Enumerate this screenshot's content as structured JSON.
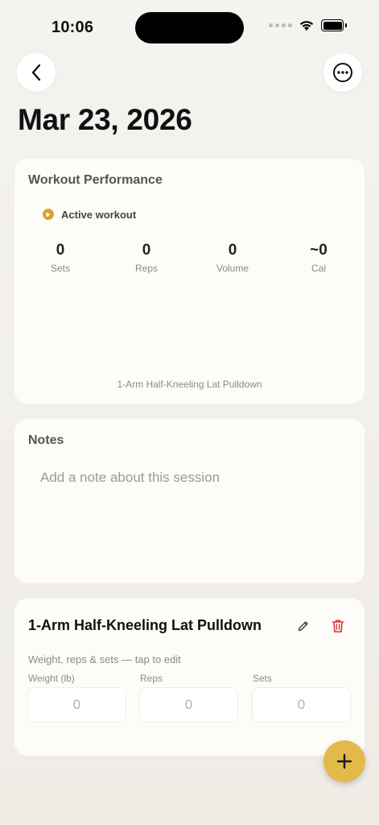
{
  "status_bar": {
    "time": "10:06"
  },
  "header": {
    "back_icon": "chevron-left-icon",
    "more_icon": "ellipsis-circle-icon",
    "title": "Mar 23, 2026"
  },
  "performance": {
    "title": "Workout Performance",
    "status_label": "Active workout",
    "accent_color": "#d4a62a",
    "stats": [
      {
        "value": "0",
        "label": "Sets"
      },
      {
        "value": "0",
        "label": "Reps"
      },
      {
        "value": "0",
        "label": "Volume"
      },
      {
        "value": "~0",
        "label": "Cal"
      }
    ],
    "exercise_caption": "1-Arm Half-Kneeling Lat Pulldown"
  },
  "notes": {
    "title": "Notes",
    "placeholder": "Add a note about this session",
    "value": ""
  },
  "exercise": {
    "name": "1-Arm Half-Kneeling Lat Pulldown",
    "edit_icon": "pencil-icon",
    "delete_icon": "trash-icon",
    "delete_color": "#d9363e",
    "hint": "Weight, reps & sets — tap to edit",
    "fields": [
      {
        "label": "Weight (lb)",
        "placeholder": "0"
      },
      {
        "label": "Reps",
        "placeholder": "0"
      },
      {
        "label": "Sets",
        "placeholder": "0"
      }
    ]
  },
  "fab": {
    "icon": "plus-icon",
    "color": "#e3b94a"
  }
}
